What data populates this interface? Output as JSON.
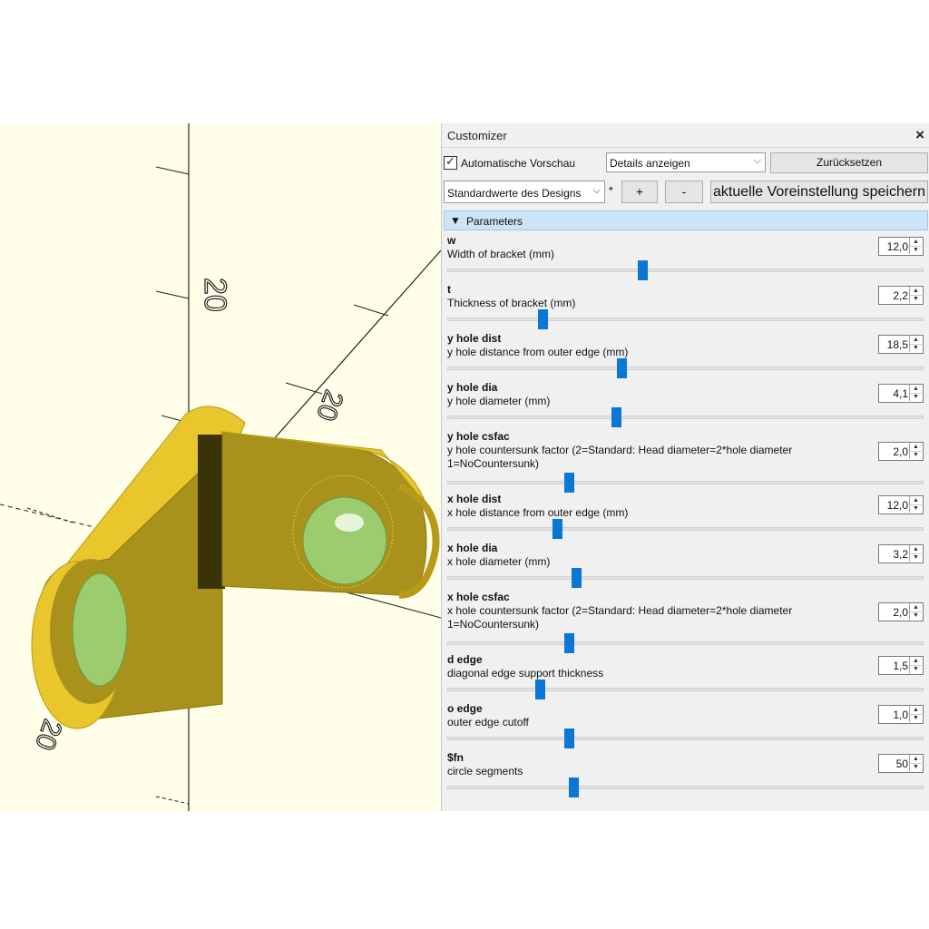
{
  "customizer": {
    "title": "Customizer",
    "close_icon": "×",
    "auto_preview": {
      "label": "Automatische Vorschau",
      "checked": true,
      "tick": "✓"
    },
    "details_select": {
      "value": "Details anzeigen",
      "arrow": "⌵"
    },
    "reset_label": "Zurücksetzen",
    "preset_select": {
      "value": "Standardwerte des Designs",
      "arrow": "⌵"
    },
    "modified_marker": "*",
    "add_label": "+",
    "remove_label": "-",
    "save_preset_label": "aktuelle Voreinstellung speichern",
    "group": {
      "arrow": "▼",
      "label": "Parameters"
    }
  },
  "spin_arrows": {
    "up": "▲",
    "down": "▼"
  },
  "parameters": [
    {
      "name": "w",
      "desc": "Width of bracket (mm)",
      "value": "12,0",
      "slider_fraction": 0.41
    },
    {
      "name": "t",
      "desc": "Thickness of bracket (mm)",
      "value": "2,2",
      "slider_fraction": 0.2
    },
    {
      "name": "y hole dist",
      "desc": "y hole distance from outer edge (mm)",
      "value": "18,5",
      "slider_fraction": 0.365
    },
    {
      "name": "y hole dia",
      "desc": "y hole diameter (mm)",
      "value": "4,1",
      "slider_fraction": 0.355
    },
    {
      "name": "y hole csfac",
      "desc": "y hole countersunk factor (2=Standard: Head diameter=2*hole diameter 1=NoCountersunk)",
      "value": "2,0",
      "slider_fraction": 0.255
    },
    {
      "name": "x hole dist",
      "desc": "x hole distance from outer edge (mm)",
      "value": "12,0",
      "slider_fraction": 0.23
    },
    {
      "name": "x hole dia",
      "desc": "x hole diameter (mm)",
      "value": "3,2",
      "slider_fraction": 0.27
    },
    {
      "name": "x hole csfac",
      "desc": "x hole countersunk factor (2=Standard: Head diameter=2*hole diameter 1=NoCountersunk)",
      "value": "2,0",
      "slider_fraction": 0.255
    },
    {
      "name": "d edge",
      "desc": "diagonal edge support thickness",
      "value": "1,5",
      "slider_fraction": 0.195
    },
    {
      "name": "o edge",
      "desc": "outer edge cutoff",
      "value": "1,0",
      "slider_fraction": 0.255
    },
    {
      "name": "$fn",
      "desc": "circle segments",
      "value": "50",
      "slider_fraction": 0.265
    }
  ],
  "viewport": {
    "axis_labels": [
      "20",
      "20",
      "20"
    ],
    "colors": {
      "background": "#fffee8",
      "part": "#e8c62c",
      "part_dark": "#a8921c",
      "hole": "#9ccc6e"
    }
  }
}
